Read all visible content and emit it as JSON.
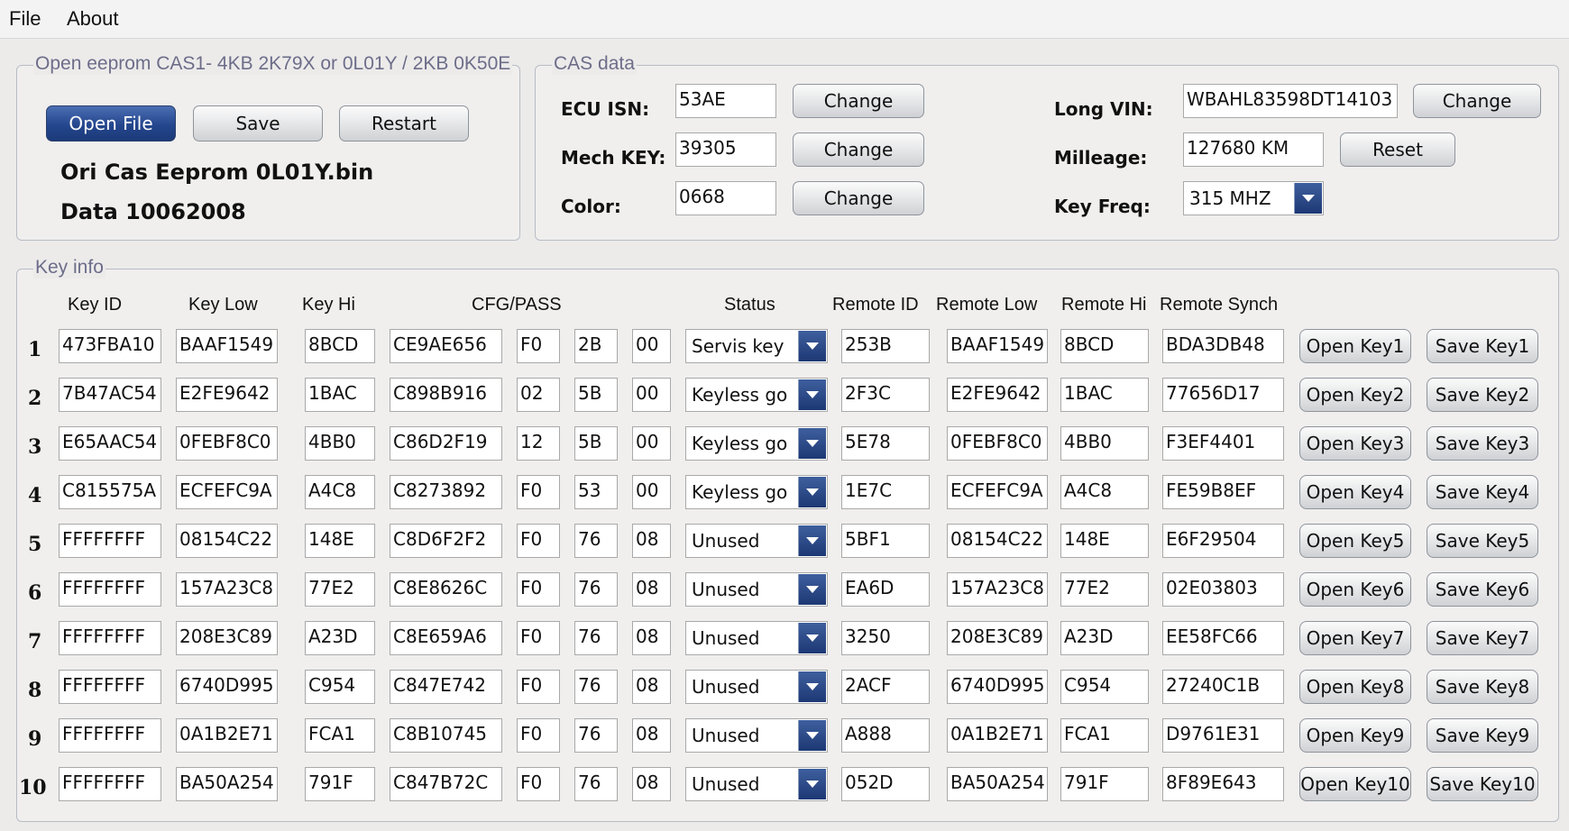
{
  "menu": {
    "file": "File",
    "about": "About"
  },
  "open_group": {
    "legend": "Open eeprom CAS1- 4KB 2K79X or 0L01Y / 2KB 0K50E",
    "open_label": "Open File",
    "save_label": "Save",
    "restart_label": "Restart",
    "filename": "Ori Cas Eeprom 0L01Y.bin",
    "data_date": "Data 10062008"
  },
  "cas": {
    "legend": "CAS data",
    "ecu_isn_label": "ECU ISN:",
    "ecu_isn": "53AE",
    "mech_key_label": "Mech KEY:",
    "mech_key": "39305",
    "color_label": "Color:",
    "color": "0668",
    "change_label": "Change",
    "vin_label": "Long VIN:",
    "vin": "WBAHL83598DT14103",
    "mileage_label": "Milleage:",
    "mileage": "127680 KM",
    "reset_label": "Reset",
    "freq_label": "Key Freq:",
    "freq": "315 MHZ"
  },
  "keys": {
    "legend": "Key info",
    "headers": {
      "key_id": "Key ID",
      "key_low": "Key Low",
      "key_hi": "Key Hi",
      "cfg": "CFG/PASS",
      "status": "Status",
      "remote_id": "Remote ID",
      "remote_low": "Remote Low",
      "remote_hi": "Remote Hi",
      "remote_synch": "Remote Synch"
    },
    "rows": [
      {
        "n": "1",
        "id": "473FBA10",
        "low": "BAAF1549",
        "hi": "8BCD",
        "cfg": "CE9AE656",
        "p1": "F0",
        "p2": "2B",
        "p3": "00",
        "status": "Servis key",
        "rid": "253B",
        "rlow": "BAAF1549",
        "rhi": "8BCD",
        "rsync": "BDA3DB48",
        "open": "Open Key1",
        "save": "Save Key1"
      },
      {
        "n": "2",
        "id": "7B47AC54",
        "low": "E2FE9642",
        "hi": "1BAC",
        "cfg": "C898B916",
        "p1": "02",
        "p2": "5B",
        "p3": "00",
        "status": "Keyless go",
        "rid": "2F3C",
        "rlow": "E2FE9642",
        "rhi": "1BAC",
        "rsync": "77656D17",
        "open": "Open Key2",
        "save": "Save Key2"
      },
      {
        "n": "3",
        "id": "E65AAC54",
        "low": "0FEBF8C0",
        "hi": "4BB0",
        "cfg": "C86D2F19",
        "p1": "12",
        "p2": "5B",
        "p3": "00",
        "status": "Keyless go",
        "rid": "5E78",
        "rlow": "0FEBF8C0",
        "rhi": "4BB0",
        "rsync": "F3EF4401",
        "open": "Open Key3",
        "save": "Save Key3"
      },
      {
        "n": "4",
        "id": "C815575A",
        "low": "ECFEFC9A",
        "hi": "A4C8",
        "cfg": "C8273892",
        "p1": "F0",
        "p2": "53",
        "p3": "00",
        "status": "Keyless go",
        "rid": "1E7C",
        "rlow": "ECFEFC9A",
        "rhi": "A4C8",
        "rsync": "FE59B8EF",
        "open": "Open Key4",
        "save": "Save Key4"
      },
      {
        "n": "5",
        "id": "FFFFFFFF",
        "low": "08154C22",
        "hi": "148E",
        "cfg": "C8D6F2F2",
        "p1": "F0",
        "p2": "76",
        "p3": "08",
        "status": "Unused",
        "rid": "5BF1",
        "rlow": "08154C22",
        "rhi": "148E",
        "rsync": "E6F29504",
        "open": "Open Key5",
        "save": "Save Key5"
      },
      {
        "n": "6",
        "id": "FFFFFFFF",
        "low": "157A23C8",
        "hi": "77E2",
        "cfg": "C8E8626C",
        "p1": "F0",
        "p2": "76",
        "p3": "08",
        "status": "Unused",
        "rid": "EA6D",
        "rlow": "157A23C8",
        "rhi": "77E2",
        "rsync": "02E03803",
        "open": "Open Key6",
        "save": "Save Key6"
      },
      {
        "n": "7",
        "id": "FFFFFFFF",
        "low": "208E3C89",
        "hi": "A23D",
        "cfg": "C8E659A6",
        "p1": "F0",
        "p2": "76",
        "p3": "08",
        "status": "Unused",
        "rid": "3250",
        "rlow": "208E3C89",
        "rhi": "A23D",
        "rsync": "EE58FC66",
        "open": "Open Key7",
        "save": "Save Key7"
      },
      {
        "n": "8",
        "id": "FFFFFFFF",
        "low": "6740D995",
        "hi": "C954",
        "cfg": "C847E742",
        "p1": "F0",
        "p2": "76",
        "p3": "08",
        "status": "Unused",
        "rid": "2ACF",
        "rlow": "6740D995",
        "rhi": "C954",
        "rsync": "27240C1B",
        "open": "Open Key8",
        "save": "Save Key8"
      },
      {
        "n": "9",
        "id": "FFFFFFFF",
        "low": "0A1B2E71",
        "hi": "FCA1",
        "cfg": "C8B10745",
        "p1": "F0",
        "p2": "76",
        "p3": "08",
        "status": "Unused",
        "rid": "A888",
        "rlow": "0A1B2E71",
        "rhi": "FCA1",
        "rsync": "D9761E31",
        "open": "Open Key9",
        "save": "Save Key9"
      },
      {
        "n": "10",
        "id": "FFFFFFFF",
        "low": "BA50A254",
        "hi": "791F",
        "cfg": "C847B72C",
        "p1": "F0",
        "p2": "76",
        "p3": "08",
        "status": "Unused",
        "rid": "052D",
        "rlow": "BA50A254",
        "rhi": "791F",
        "rsync": "8F89E643",
        "open": "Open Key10",
        "save": "Save Key10"
      }
    ]
  }
}
